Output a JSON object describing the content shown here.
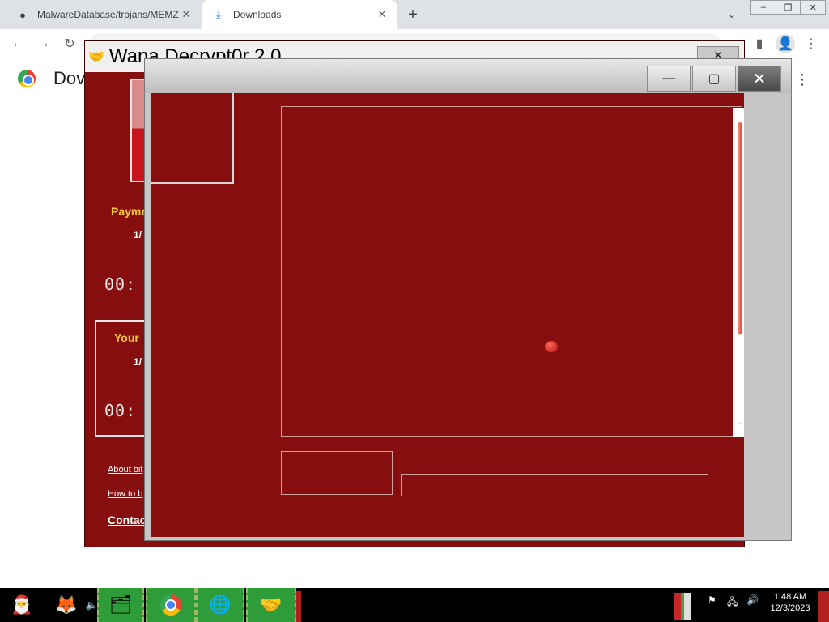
{
  "browser": {
    "tabs": [
      {
        "title": "MalwareDatabase/trojans/MEMZ",
        "active": false
      },
      {
        "title": "Downloads",
        "active": true
      }
    ],
    "new_tab": "+",
    "page_heading": "Dov",
    "omnibox_text": ""
  },
  "wana": {
    "title": "Wana Decrypt0r 2.0",
    "payment_label": "Payme",
    "payment_date": "1/",
    "timer1": "00:",
    "lost_label": "Your",
    "lost_date": "1/",
    "timer2": "00:",
    "link_about": "About bit",
    "link_howto": "How to b",
    "link_contact": "Contac",
    "help": "?"
  },
  "front": {
    "minimize": "—",
    "maximize": "▢",
    "close": "✕"
  },
  "taskbar": {
    "clock_time": "1:48 AM",
    "clock_date": "12/3/2023"
  },
  "colors": {
    "wana_red": "#870e0e",
    "label_yellow": "#f2c53d",
    "taskbar_green": "#2f9c3a"
  }
}
